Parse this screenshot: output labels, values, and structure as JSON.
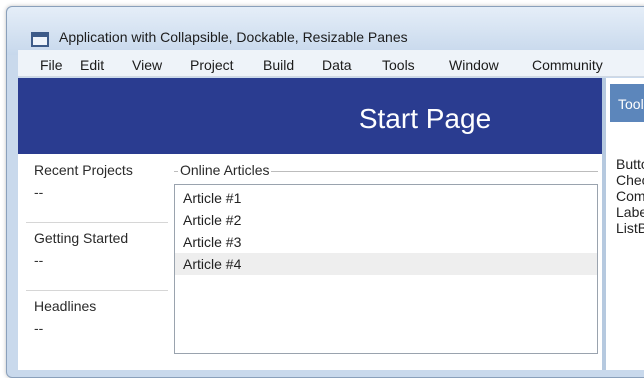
{
  "window": {
    "title": "Application with Collapsible, Dockable, Resizable Panes"
  },
  "menu": [
    "File",
    "Edit",
    "View",
    "Project",
    "Build",
    "Data",
    "Tools",
    "Window",
    "Community"
  ],
  "start_page": {
    "title": "Start Page"
  },
  "left_panes": [
    {
      "title": "Recent Projects",
      "value": "--"
    },
    {
      "title": "Getting Started",
      "value": "--"
    },
    {
      "title": "Headlines",
      "value": "--"
    }
  ],
  "online_articles": {
    "title": "Online Articles",
    "items": [
      "Article #1",
      "Article #2",
      "Article #3",
      "Article #4"
    ],
    "selected_index": 3
  },
  "toolbox": {
    "title": "Toolbox",
    "items": [
      "Button",
      "CheckBox",
      "ComboBox",
      "Label",
      "ListBox"
    ]
  }
}
